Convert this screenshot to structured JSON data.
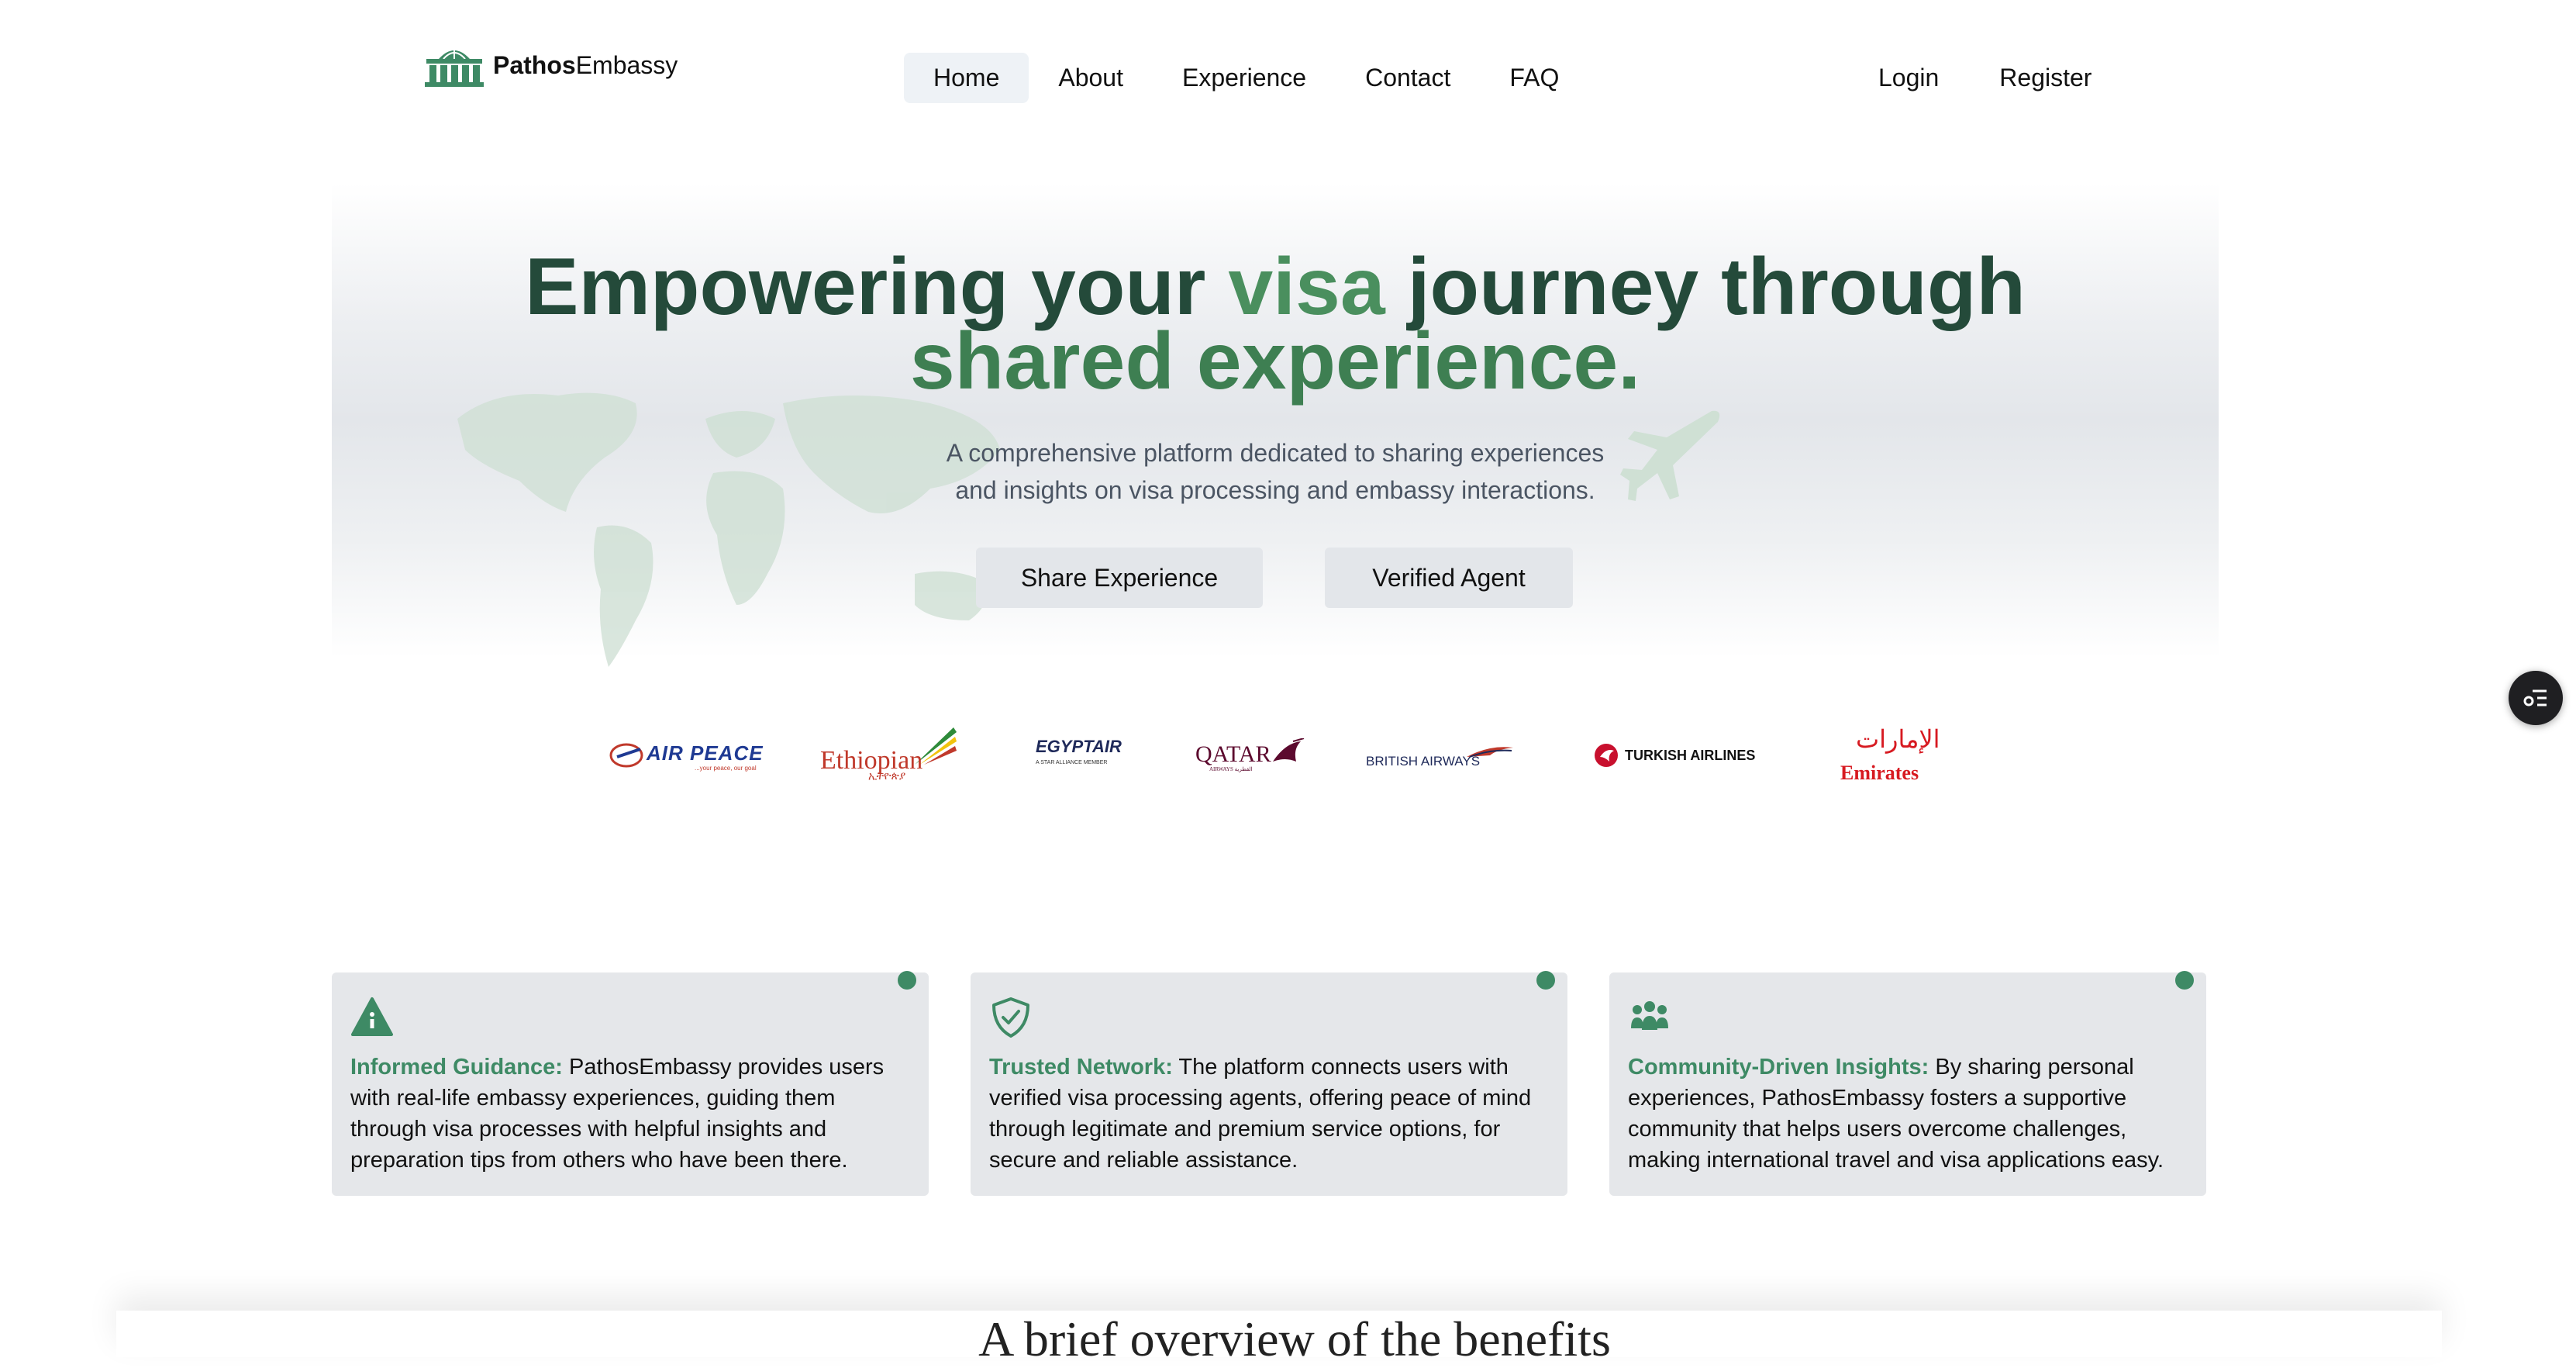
{
  "brand": {
    "name_bold": "Pathos",
    "name_regular": "Embassy",
    "accent": "#3e8a65"
  },
  "nav": {
    "items": [
      {
        "label": "Home",
        "active": true
      },
      {
        "label": "About"
      },
      {
        "label": "Experience"
      },
      {
        "label": "Contact"
      },
      {
        "label": "FAQ"
      }
    ],
    "login": "Login",
    "register": "Register"
  },
  "hero": {
    "title_part1": "Empowering your ",
    "title_highlight": "visa",
    "title_part2": " journey through",
    "title_line2": "shared experience.",
    "subtitle_line1": "A comprehensive platform dedicated to sharing experiences",
    "subtitle_line2": "and insights on visa processing and embassy interactions.",
    "share_button": "Share Experience",
    "agent_button": "Verified Agent"
  },
  "airlines": {
    "air_peace": "AIR PEACE",
    "air_peace_tagline": "...your peace, our goal",
    "ethiopian": "Ethiopian",
    "ethiopian_amharic": "ኢትዮጵያ",
    "egyptair": "EGYPTAIR",
    "egyptair_tagline": "A STAR ALLIANCE MEMBER",
    "qatar": "QATAR",
    "qatar_sub": "AIRWAYS القطرية",
    "british": "BRITISH AIRWAYS",
    "turkish": "TURKISH AIRLINES",
    "emirates": "Emirates",
    "emirates_arabic": "الإمارات"
  },
  "features": [
    {
      "icon": "info-triangle-icon",
      "title": "Informed Guidance:",
      "body": " PathosEmbassy provides users with real-life embassy experiences, guiding them through visa processes with helpful insights and preparation tips from others who have been there."
    },
    {
      "icon": "shield-check-icon",
      "title": "Trusted Network:",
      "body": " The platform connects users with verified visa processing agents, offering peace of mind through legitimate and premium service options, for secure and reliable assistance."
    },
    {
      "icon": "people-group-icon",
      "title": "Community-Driven Insights:",
      "body": " By sharing personal experiences, PathosEmbassy fosters a supportive community that helps users overcome challenges, making international travel and visa applications easy."
    }
  ],
  "next_section": {
    "title": "A brief overview of the benefits"
  }
}
